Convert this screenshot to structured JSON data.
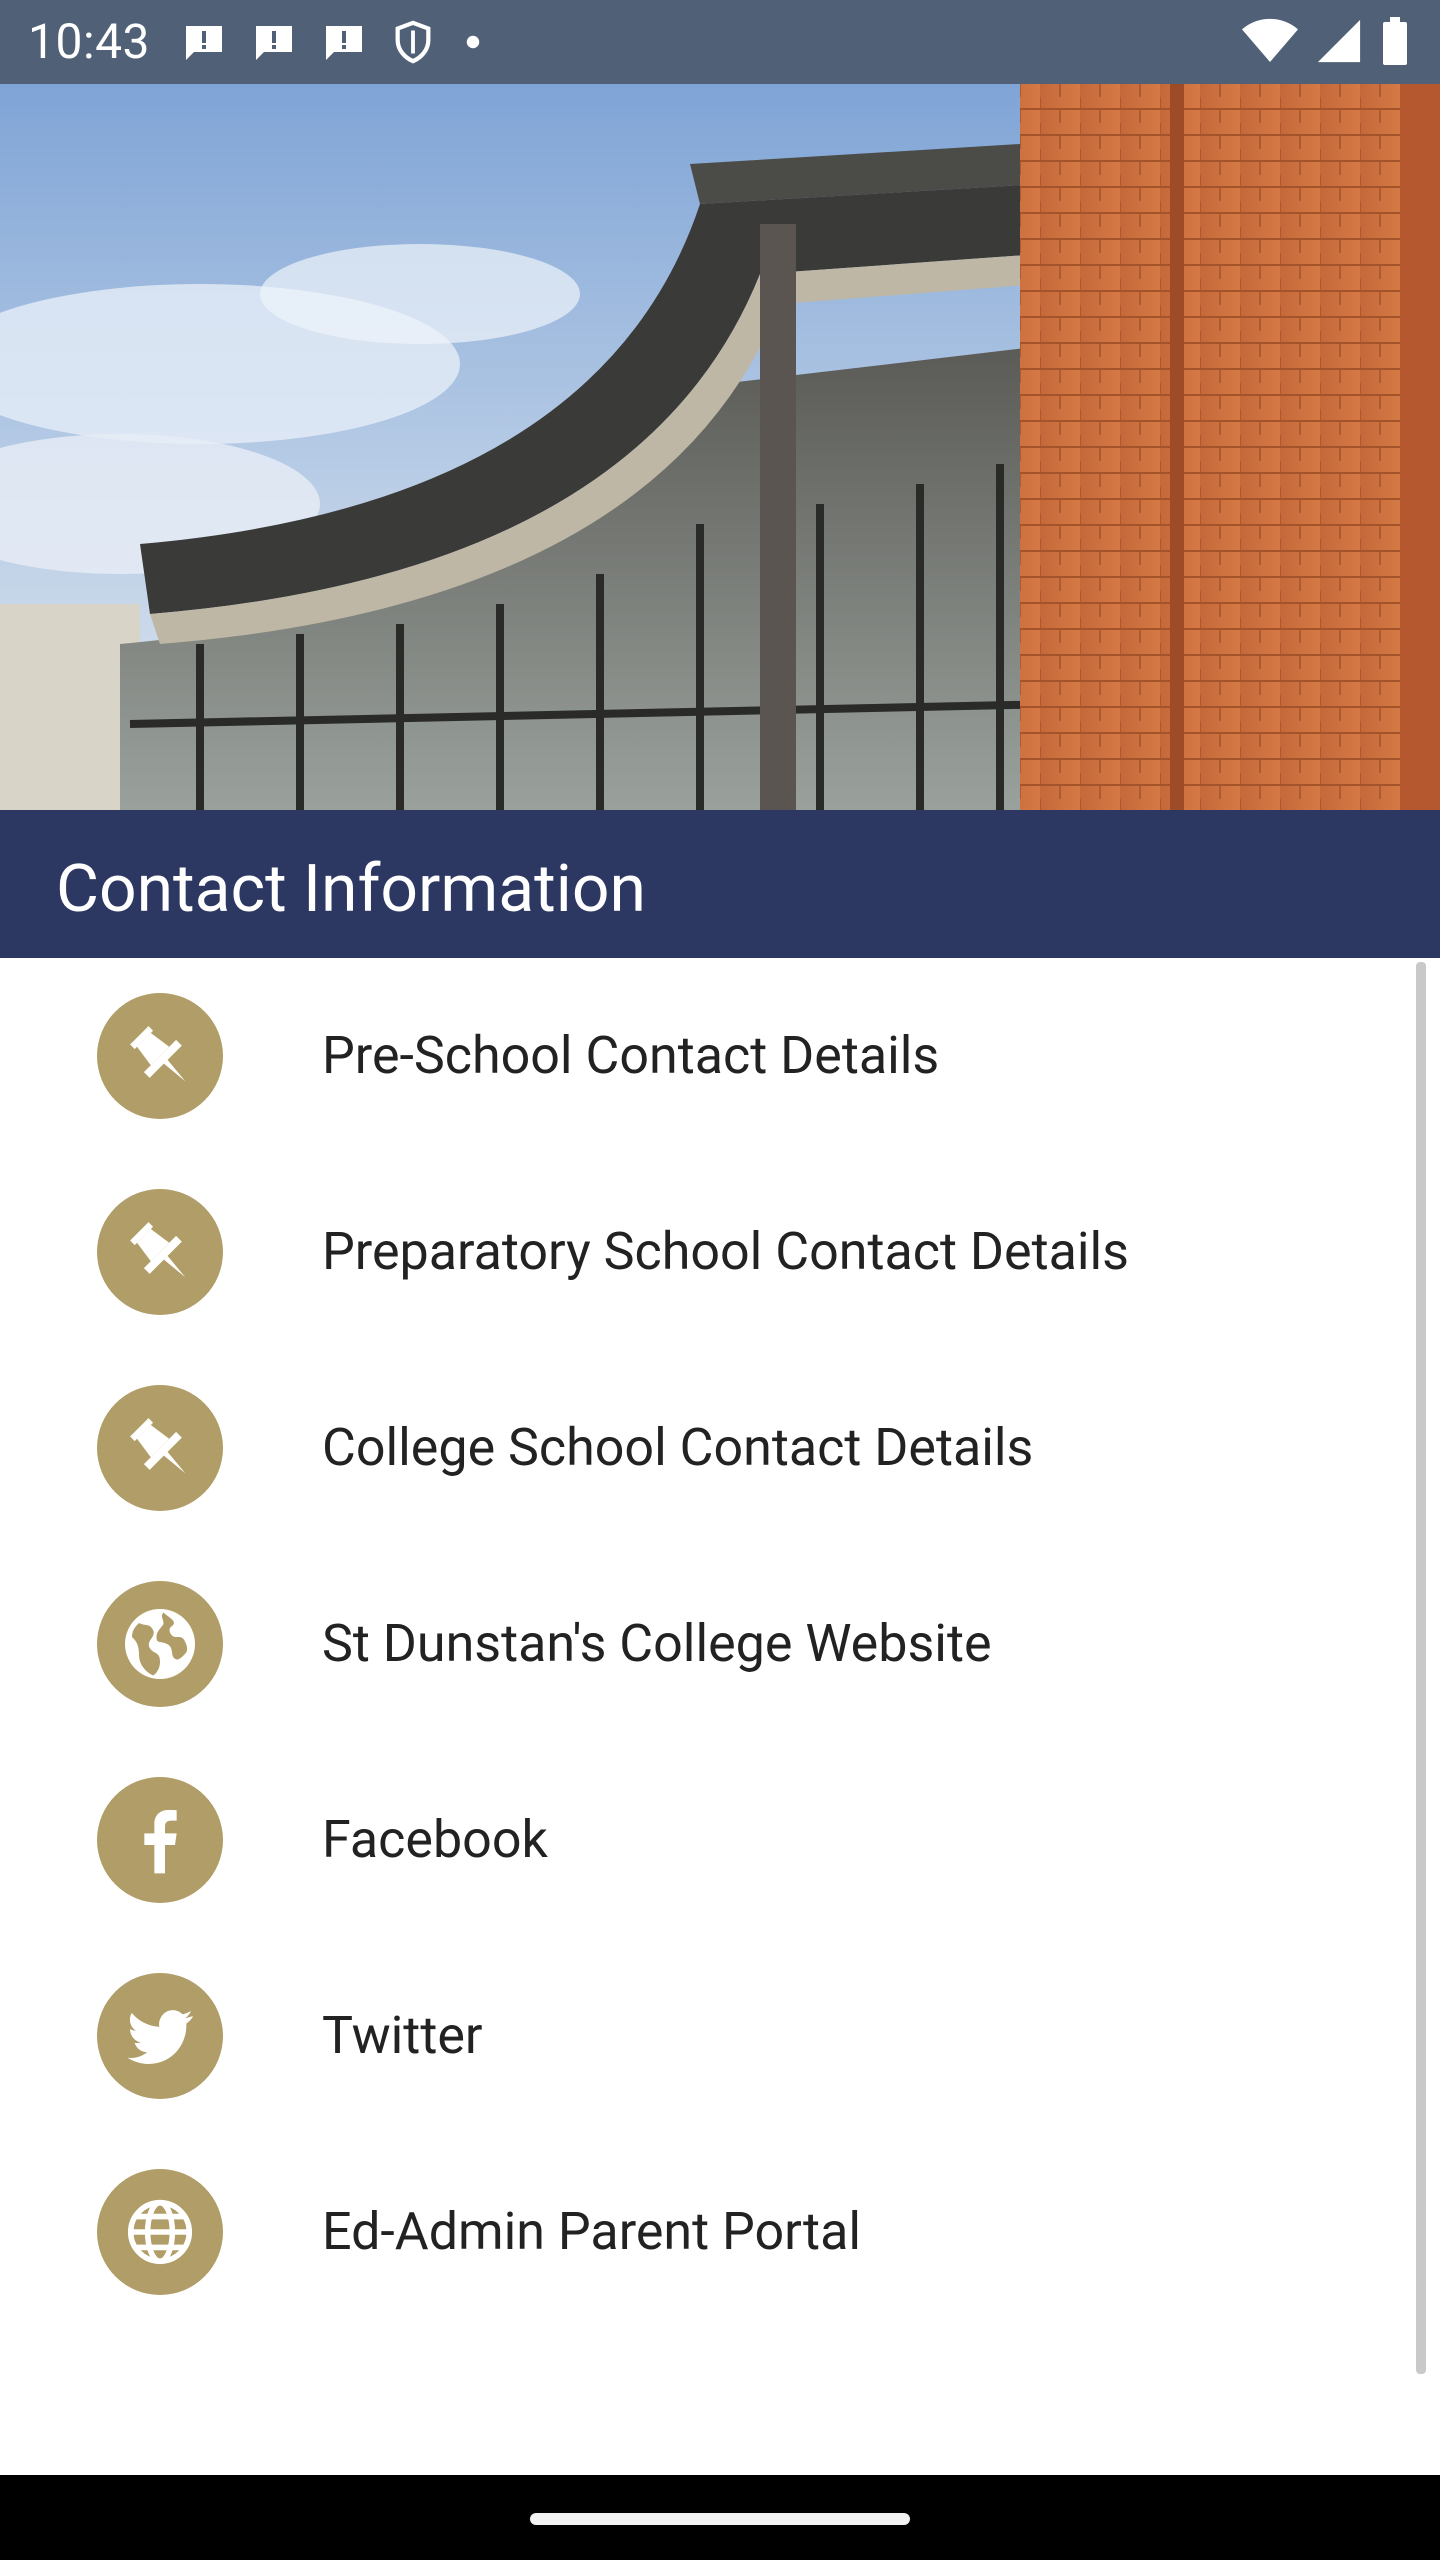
{
  "status_bar": {
    "time": "10:43",
    "left_icons": [
      "alert-icon",
      "alert-icon",
      "alert-icon",
      "shield-icon",
      "dot-icon"
    ],
    "right_icons": [
      "wifi-icon",
      "signal-icon",
      "battery-icon"
    ]
  },
  "hero": {
    "description_icon": "building-photo"
  },
  "section": {
    "title": "Contact Information"
  },
  "contacts": [
    {
      "label": "Pre-School Contact Details",
      "icon": "pin-icon"
    },
    {
      "label": "Preparatory School Contact Details",
      "icon": "pin-icon"
    },
    {
      "label": "College School Contact Details",
      "icon": "pin-icon"
    },
    {
      "label": "St Dunstan's College Website",
      "icon": "globe-icon"
    },
    {
      "label": "Facebook",
      "icon": "facebook-icon"
    },
    {
      "label": "Twitter",
      "icon": "twitter-icon"
    },
    {
      "label": "Ed-Admin Parent Portal",
      "icon": "web-icon"
    }
  ],
  "colors": {
    "status_bar": "#4f6077",
    "header": "#2d3862",
    "icon_circle": "#b09d67",
    "text": "#222222"
  }
}
